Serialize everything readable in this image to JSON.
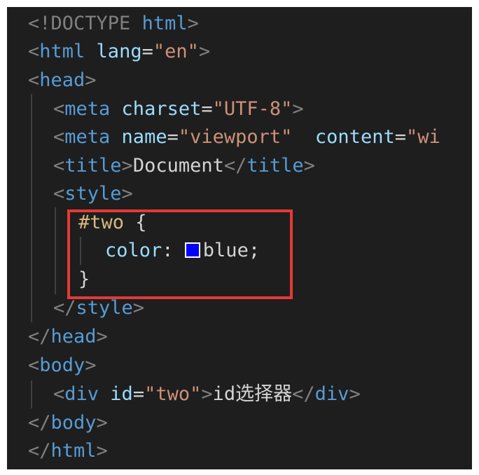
{
  "code": {
    "lines": [
      "<!DOCTYPE html>",
      "<html lang=\"en\">",
      "<head>",
      "<meta charset=\"UTF-8\">",
      "<meta name=\"viewport\" content=\"wi",
      "<title>Document</title>",
      "<style>",
      "#two {",
      "color: blue;",
      "}",
      "</style>",
      "</head>",
      "<body>",
      "<div id=\"two\">id选择器</div>",
      "</body>",
      "</html>"
    ],
    "tokens": {
      "doctype_open": "<!DOCTYPE",
      "doctype_html": " html",
      "gt": ">",
      "lt": "<",
      "lt_slash": "</",
      "html": "html",
      "lang_attr": " lang",
      "lang_val": "\"en\"",
      "head": "head",
      "meta": "meta",
      "charset_attr": " charset",
      "charset_val": "\"UTF-8\"",
      "name_attr": " name",
      "name_val": "\"viewport\"",
      "content_attr": "  content",
      "content_val": "\"wi",
      "equals": "=",
      "title": "title",
      "title_text": "Document",
      "style": "style",
      "selector": "#two",
      "brace_open": " {",
      "prop": "color",
      "colon": ": ",
      "value": "blue;",
      "brace_close": "}",
      "body": "body",
      "div": "div",
      "id_attr": " id",
      "id_val": "\"two\"",
      "div_text": "id选择器"
    },
    "swatch_color": "#0000ff"
  },
  "colors": {
    "background": "#1e1e1e",
    "tag": "#569cd6",
    "attribute": "#9cdcfe",
    "string": "#ce9178",
    "selector": "#d7ba7d",
    "bracket": "#808080",
    "highlight_box": "#e53935"
  }
}
